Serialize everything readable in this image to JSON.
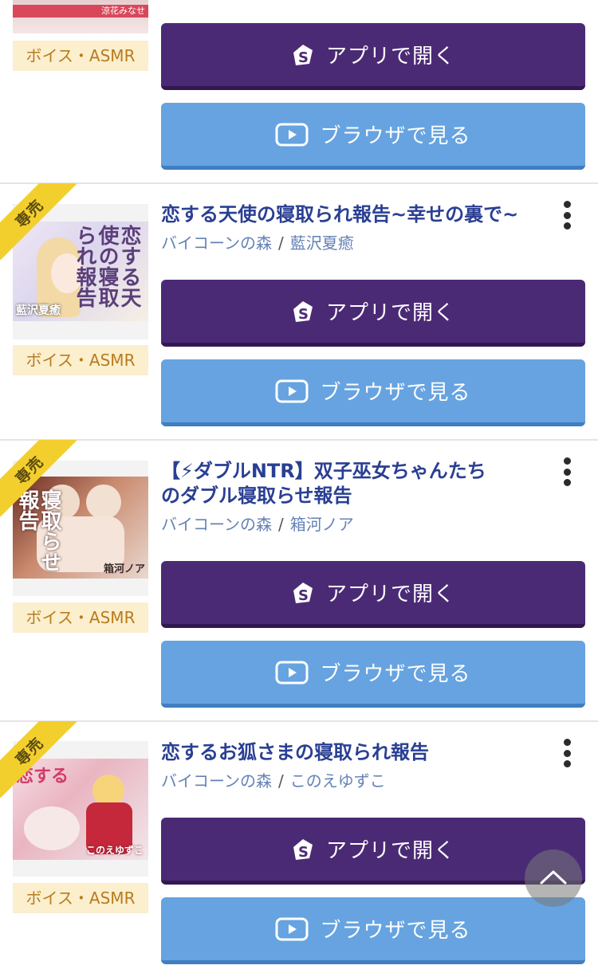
{
  "buttons": {
    "app_label": "アプリで開く",
    "browser_label": "ブラウザで見る"
  },
  "colors": {
    "title": "#2a3f93",
    "meta_link": "#6482b6",
    "app_button": "#4b2a75",
    "browser_button": "#66a3e0",
    "genre_badge_bg": "#fbefce",
    "genre_badge_text": "#b87c1e",
    "ribbon": "#f3cf2e"
  },
  "items": [
    {
      "genre": "ボイス・ASMR",
      "thumb_caption": "涼花みなせ"
    },
    {
      "exclusive": "専売",
      "title": "恋する天使の寝取られ報告~幸せの裏で~",
      "circle": "バイコーンの森",
      "cast": "藍沢夏癒",
      "genre": "ボイス・ASMR",
      "thumb_text": "恋する天使の寝取られ報告",
      "thumb_caption": "藍沢夏癒"
    },
    {
      "exclusive": "専売",
      "title_line1": "【⚡ダブルNTR】双子巫女ちゃんたち",
      "title_line2": "のダブル寝取らせ報告",
      "circle": "バイコーンの森",
      "cast": "箱河ノア",
      "genre": "ボイス・ASMR",
      "thumb_text": "寝取らせ報告",
      "thumb_caption": "箱河ノア"
    },
    {
      "exclusive": "専売",
      "title": "恋するお狐さまの寝取られ報告",
      "circle": "バイコーンの森",
      "cast": "このえゆずこ",
      "genre": "ボイス・ASMR",
      "thumb_text": "恋する",
      "thumb_caption": "このえゆずこ"
    }
  ],
  "icons": {
    "app": "app-logo-icon",
    "browser": "play-icon",
    "more": "kebab-menu-icon",
    "scroll_top": "chevron-up-icon"
  }
}
